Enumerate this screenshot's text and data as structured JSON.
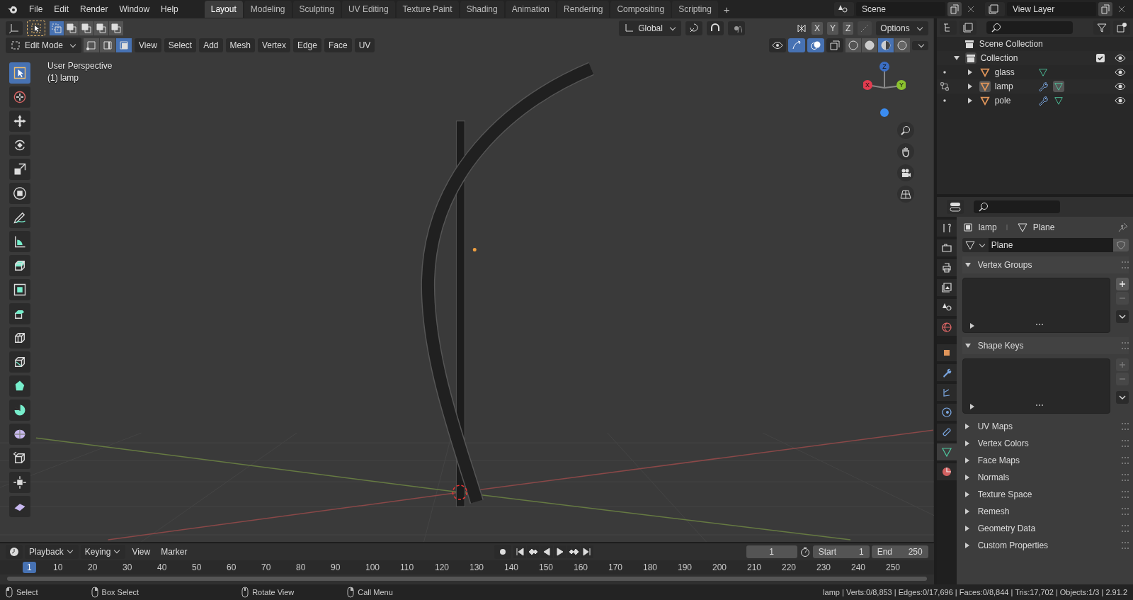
{
  "top_bar": {
    "menus": [
      "File",
      "Edit",
      "Render",
      "Window",
      "Help"
    ],
    "workspaces": [
      {
        "label": "Layout",
        "selected": true
      },
      {
        "label": "Modeling",
        "selected": false
      },
      {
        "label": "Sculpting",
        "selected": false
      },
      {
        "label": "UV Editing",
        "selected": false
      },
      {
        "label": "Texture Paint",
        "selected": false
      },
      {
        "label": "Shading",
        "selected": false
      },
      {
        "label": "Animation",
        "selected": false
      },
      {
        "label": "Rendering",
        "selected": false
      },
      {
        "label": "Compositing",
        "selected": false
      },
      {
        "label": "Scripting",
        "selected": false
      }
    ],
    "add_tab": "+",
    "scene": "Scene",
    "view_layer": "View Layer"
  },
  "viewport": {
    "mode": "Edit Mode",
    "select_modes": [
      {
        "selected": false
      },
      {
        "selected": false
      },
      {
        "selected": true
      }
    ],
    "menus": [
      "View",
      "Select",
      "Add",
      "Mesh",
      "Vertex",
      "Edge",
      "Face",
      "UV"
    ],
    "orientation": "Global",
    "axes": [
      "X",
      "Y",
      "Z"
    ],
    "options": "Options",
    "gizmos_on": true,
    "overlays_on": true,
    "shading": [
      {
        "selected": false
      },
      {
        "selected": false
      },
      {
        "selected": true
      },
      {
        "selected": false
      }
    ],
    "info": [
      "User Perspective",
      "(1) lamp"
    ],
    "gizmo_axes": [
      "X",
      "Y",
      "Z"
    ],
    "tools": [
      {
        "selected": true
      },
      {
        "selected": false
      },
      {
        "selected": false
      },
      {
        "selected": false
      },
      {
        "selected": false
      },
      {
        "selected": false
      },
      {
        "selected": false
      },
      {
        "selected": false
      },
      {
        "selected": false
      },
      {
        "selected": false
      },
      {
        "selected": false
      },
      {
        "selected": false
      },
      {
        "selected": false
      },
      {
        "selected": false
      },
      {
        "selected": false
      },
      {
        "selected": false
      },
      {
        "selected": false
      },
      {
        "selected": false
      },
      {
        "selected": false
      }
    ]
  },
  "outliner": {
    "tree": [
      {
        "label": "Scene Collection",
        "children": [
          {
            "label": "Collection",
            "checked": true,
            "visible": true,
            "expanded": true,
            "children": [
              {
                "label": "glass",
                "selected": false,
                "modifier": false,
                "visible": true,
                "expanded": false
              },
              {
                "label": "lamp",
                "selected": true,
                "modifier": true,
                "visible": true,
                "expanded": false
              },
              {
                "label": "pole",
                "selected": false,
                "modifier": true,
                "visible": true,
                "expanded": false
              }
            ]
          }
        ]
      }
    ]
  },
  "properties": {
    "tabs": [
      {
        "selected": false
      },
      {
        "selected": false
      },
      {
        "selected": false
      },
      {
        "selected": false
      },
      {
        "selected": false
      },
      {
        "selected": false
      },
      {
        "selected": false
      },
      {
        "selected": false
      },
      {
        "selected": false
      },
      {
        "selected": false
      },
      {
        "selected": false
      },
      {
        "selected": true
      },
      {
        "selected": false
      }
    ],
    "object": "lamp",
    "mesh": "Plane",
    "mesh_name": "Plane",
    "panels": [
      {
        "label": "Vertex Groups",
        "expanded": true
      },
      {
        "label": "Shape Keys",
        "expanded": true
      },
      {
        "label": "UV Maps",
        "expanded": false
      },
      {
        "label": "Vertex Colors",
        "expanded": false
      },
      {
        "label": "Face Maps",
        "expanded": false
      },
      {
        "label": "Normals",
        "expanded": false
      },
      {
        "label": "Texture Space",
        "expanded": false
      },
      {
        "label": "Remesh",
        "expanded": false
      },
      {
        "label": "Geometry Data",
        "expanded": false
      },
      {
        "label": "Custom Properties",
        "expanded": false
      }
    ]
  },
  "timeline": {
    "menus": [
      "Playback",
      "Keying",
      "View",
      "Marker"
    ],
    "current_frame": "1",
    "start_label": "Start",
    "start": "1",
    "end_label": "End",
    "end": "250",
    "ruler": [
      "1",
      "10",
      "20",
      "30",
      "40",
      "50",
      "60",
      "70",
      "80",
      "90",
      "100",
      "110",
      "120",
      "130",
      "140",
      "150",
      "160",
      "170",
      "180",
      "190",
      "200",
      "210",
      "220",
      "230",
      "240",
      "250"
    ]
  },
  "status_bar": {
    "items": [
      "Select",
      "Box Select",
      "Rotate View",
      "Call Menu"
    ],
    "stats": "lamp | Verts:0/8,853 | Edges:0/17,696 | Faces:0/8,844 | Tris:17,702 | Objects:1/3 | 2.91.2"
  }
}
